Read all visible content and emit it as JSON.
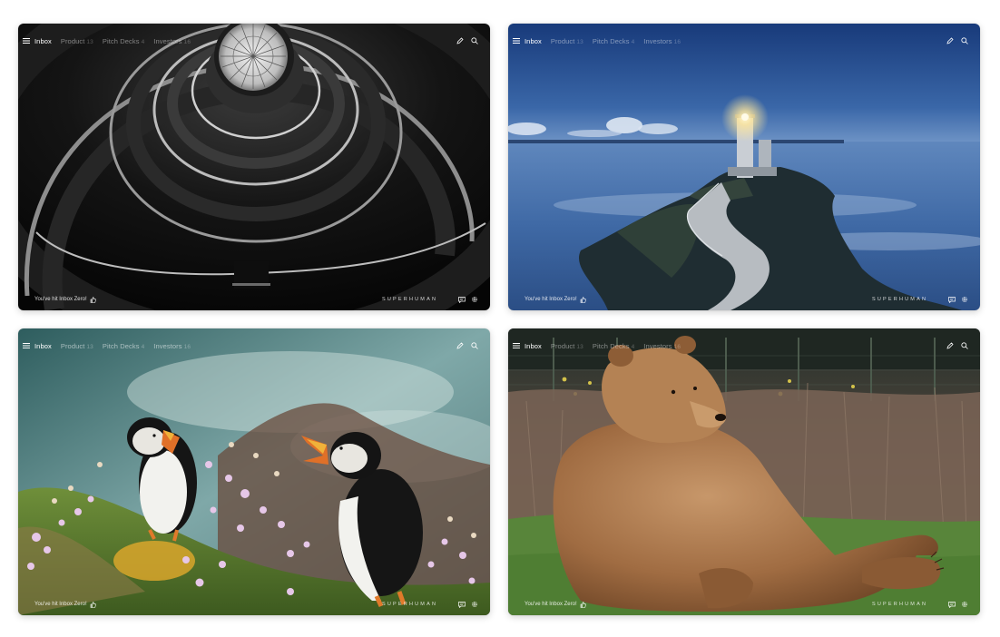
{
  "screens": [
    {
      "tabs": [
        {
          "label": "Inbox",
          "count": ""
        },
        {
          "label": "Product",
          "count": "13"
        },
        {
          "label": "Pitch Decks",
          "count": "4"
        },
        {
          "label": "Investors",
          "count": "16"
        }
      ],
      "inbox_zero": "You've hit Inbox Zero!",
      "brand": "SUPERHUMAN",
      "photo": "spiral staircase"
    },
    {
      "tabs": [
        {
          "label": "Inbox",
          "count": ""
        },
        {
          "label": "Product",
          "count": "13"
        },
        {
          "label": "Pitch Decks",
          "count": "4"
        },
        {
          "label": "Investors",
          "count": "16"
        }
      ],
      "inbox_zero": "You've hit Inbox Zero!",
      "brand": "SUPERHUMAN",
      "photo": "lighthouse at dusk"
    },
    {
      "tabs": [
        {
          "label": "Inbox",
          "count": ""
        },
        {
          "label": "Product",
          "count": "13"
        },
        {
          "label": "Pitch Decks",
          "count": "4"
        },
        {
          "label": "Investors",
          "count": "16"
        }
      ],
      "inbox_zero": "You've hit Inbox Zero!",
      "brand": "SUPERHUMAN",
      "photo": "puffins"
    },
    {
      "tabs": [
        {
          "label": "Inbox",
          "count": ""
        },
        {
          "label": "Product",
          "count": "13"
        },
        {
          "label": "Pitch Decks",
          "count": "4"
        },
        {
          "label": "Investors",
          "count": "16"
        }
      ],
      "inbox_zero": "You've hit Inbox Zero!",
      "brand": "SUPERHUMAN",
      "photo": "brown bear"
    }
  ],
  "icons": {
    "menu": "menu-icon",
    "compose": "compose-icon",
    "search": "search-icon",
    "thumbs_up": "thumbs-up-icon",
    "chat": "chat-icon",
    "settings": "gear-icon"
  }
}
